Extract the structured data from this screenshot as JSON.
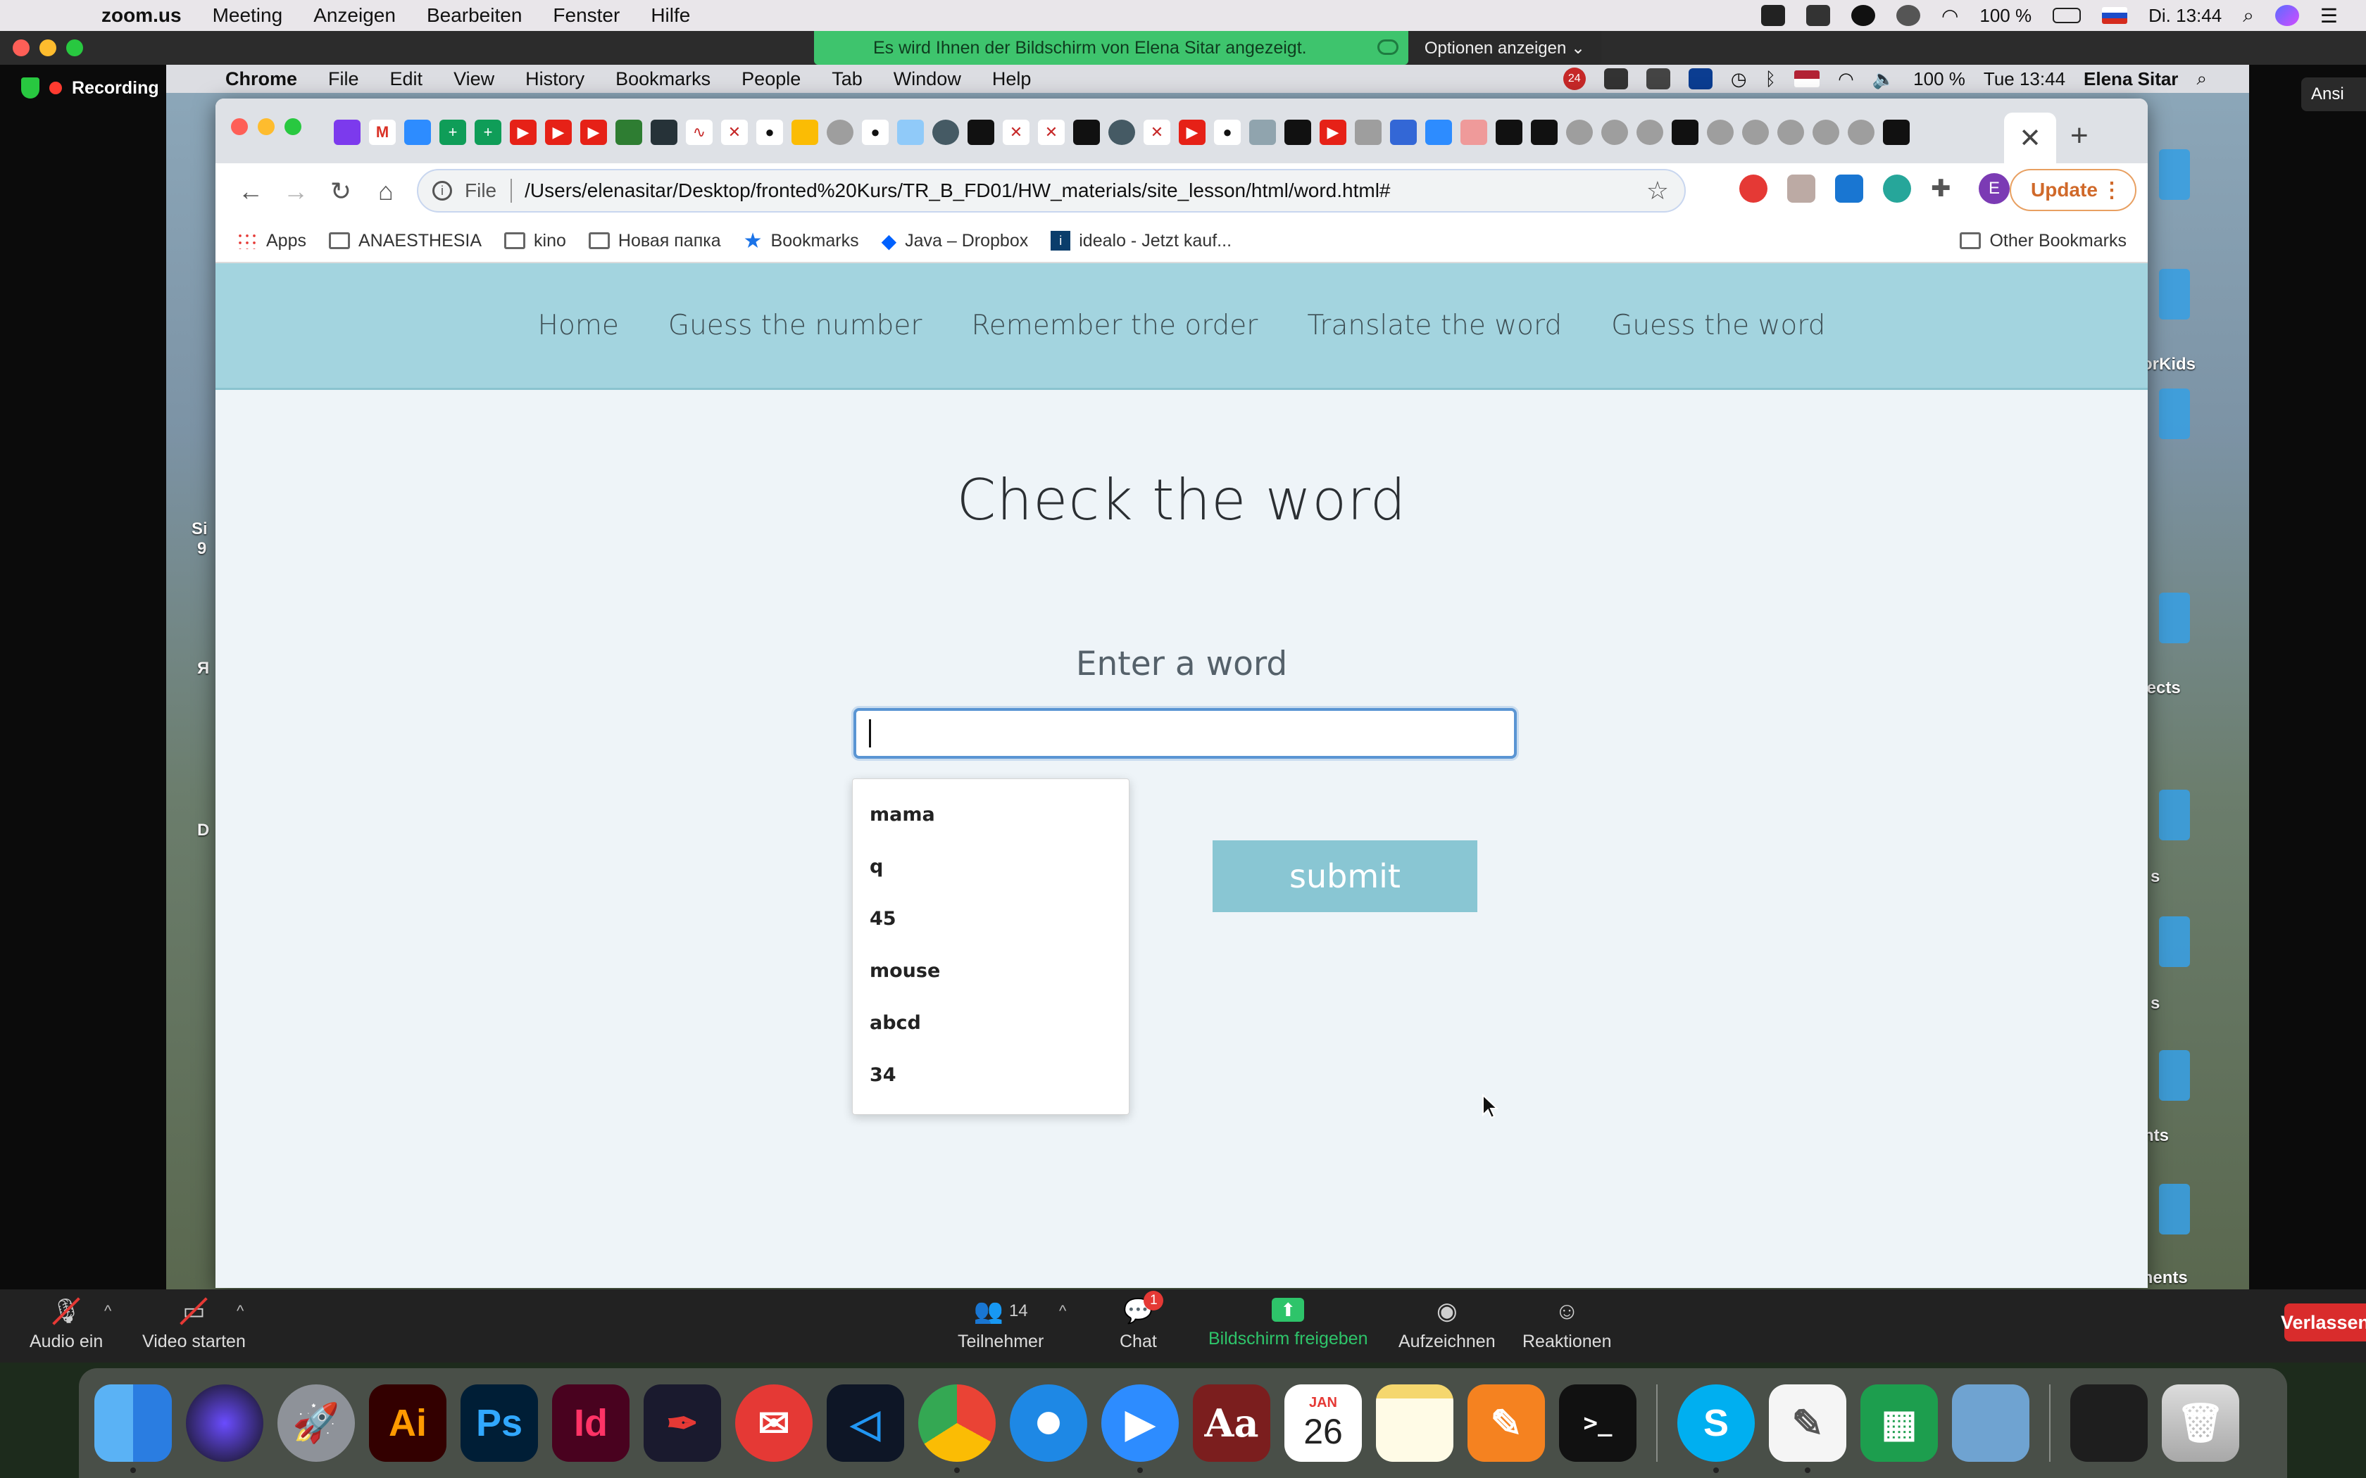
{
  "host_menubar": {
    "app": "zoom.us",
    "items": [
      "Meeting",
      "Anzeigen",
      "Bearbeiten",
      "Fenster",
      "Hilfe"
    ],
    "battery": "100 %",
    "clock": "Di. 13:44"
  },
  "share_banner": {
    "text": "Es wird Ihnen der Bildschirm von Elena Sitar angezeigt.",
    "options": "Optionen anzeigen ⌄"
  },
  "recording": {
    "label": "Recording"
  },
  "ansicht": {
    "label": "Ansi"
  },
  "remote_menubar": {
    "app": "Chrome",
    "items": [
      "File",
      "Edit",
      "View",
      "History",
      "Bookmarks",
      "People",
      "Tab",
      "Window",
      "Help"
    ],
    "battery": "100 %",
    "clock": "Tue 13:44",
    "user": "Elena Sitar",
    "badge": "24"
  },
  "desktop_labels": [
    "orKids",
    "jects",
    "s",
    "s",
    "nts",
    "ments",
    "Si",
    "9",
    "Я",
    "D"
  ],
  "chrome": {
    "tab_close": "✕",
    "new_tab": "+",
    "omnibox": {
      "scheme": "File",
      "url": "/Users/elenasitar/Desktop/fronted%20Kurs/TR_B_FD01/HW_materials/site_lesson/html/word.html#"
    },
    "avatar_letter": "E",
    "update_label": "Update",
    "bookmarks": [
      {
        "icon": "apps-grid-icon",
        "label": "Apps"
      },
      {
        "icon": "folder-icon",
        "label": "ANAESTHESIA"
      },
      {
        "icon": "folder-icon",
        "label": "kino"
      },
      {
        "icon": "folder-icon",
        "label": "Новая папка"
      },
      {
        "icon": "star-icon",
        "label": "Bookmarks"
      },
      {
        "icon": "dropbox-icon",
        "label": "Java – Dropbox"
      },
      {
        "icon": "idealo-icon",
        "label": "idealo - Jetzt kauf..."
      }
    ],
    "other_bookmarks": "Other Bookmarks"
  },
  "site": {
    "nav": [
      "Home",
      "Guess the number",
      "Remember the order",
      "Translate the word",
      "Guess the word"
    ],
    "title": "Check the word",
    "prompt": "Enter a word",
    "input_value": "",
    "submit_label": "submit",
    "autocomplete": [
      "mama",
      "q",
      "45",
      "mouse",
      "abcd",
      "34"
    ]
  },
  "zoom_bar": {
    "audio": "Audio ein",
    "video": "Video starten",
    "participants_count": "14",
    "participants": "Teilnehmer",
    "chat": "Chat",
    "chat_badge": "1",
    "share": "Bildschirm freigeben",
    "record": "Aufzeichnen",
    "reactions": "Reaktionen",
    "leave": "Verlassen"
  },
  "dock": {
    "apps": [
      "finder",
      "siri",
      "launchpad",
      "illustrator",
      "photoshop",
      "indesign",
      "acrobat",
      "mail",
      "vscode",
      "chrome",
      "safari",
      "zoom",
      "dictionary",
      "calendar",
      "notes",
      "pages",
      "terminal",
      "skype",
      "textedit",
      "numbers",
      "preview",
      "screenshot",
      "trash"
    ],
    "illustrator": "Ai",
    "photoshop": "Ps",
    "indesign": "Id",
    "dictionary": "Aa",
    "calendar_month": "JAN",
    "calendar_day": "26",
    "terminal": ">_"
  },
  "colors": {
    "site_nav_bg": "#a3d4df",
    "page_bg": "#eef4f8",
    "submit_bg": "#89c6d3",
    "input_focus": "#5a95d3",
    "zoom_green": "#2ec46a",
    "leave_red": "#d92c2c"
  }
}
